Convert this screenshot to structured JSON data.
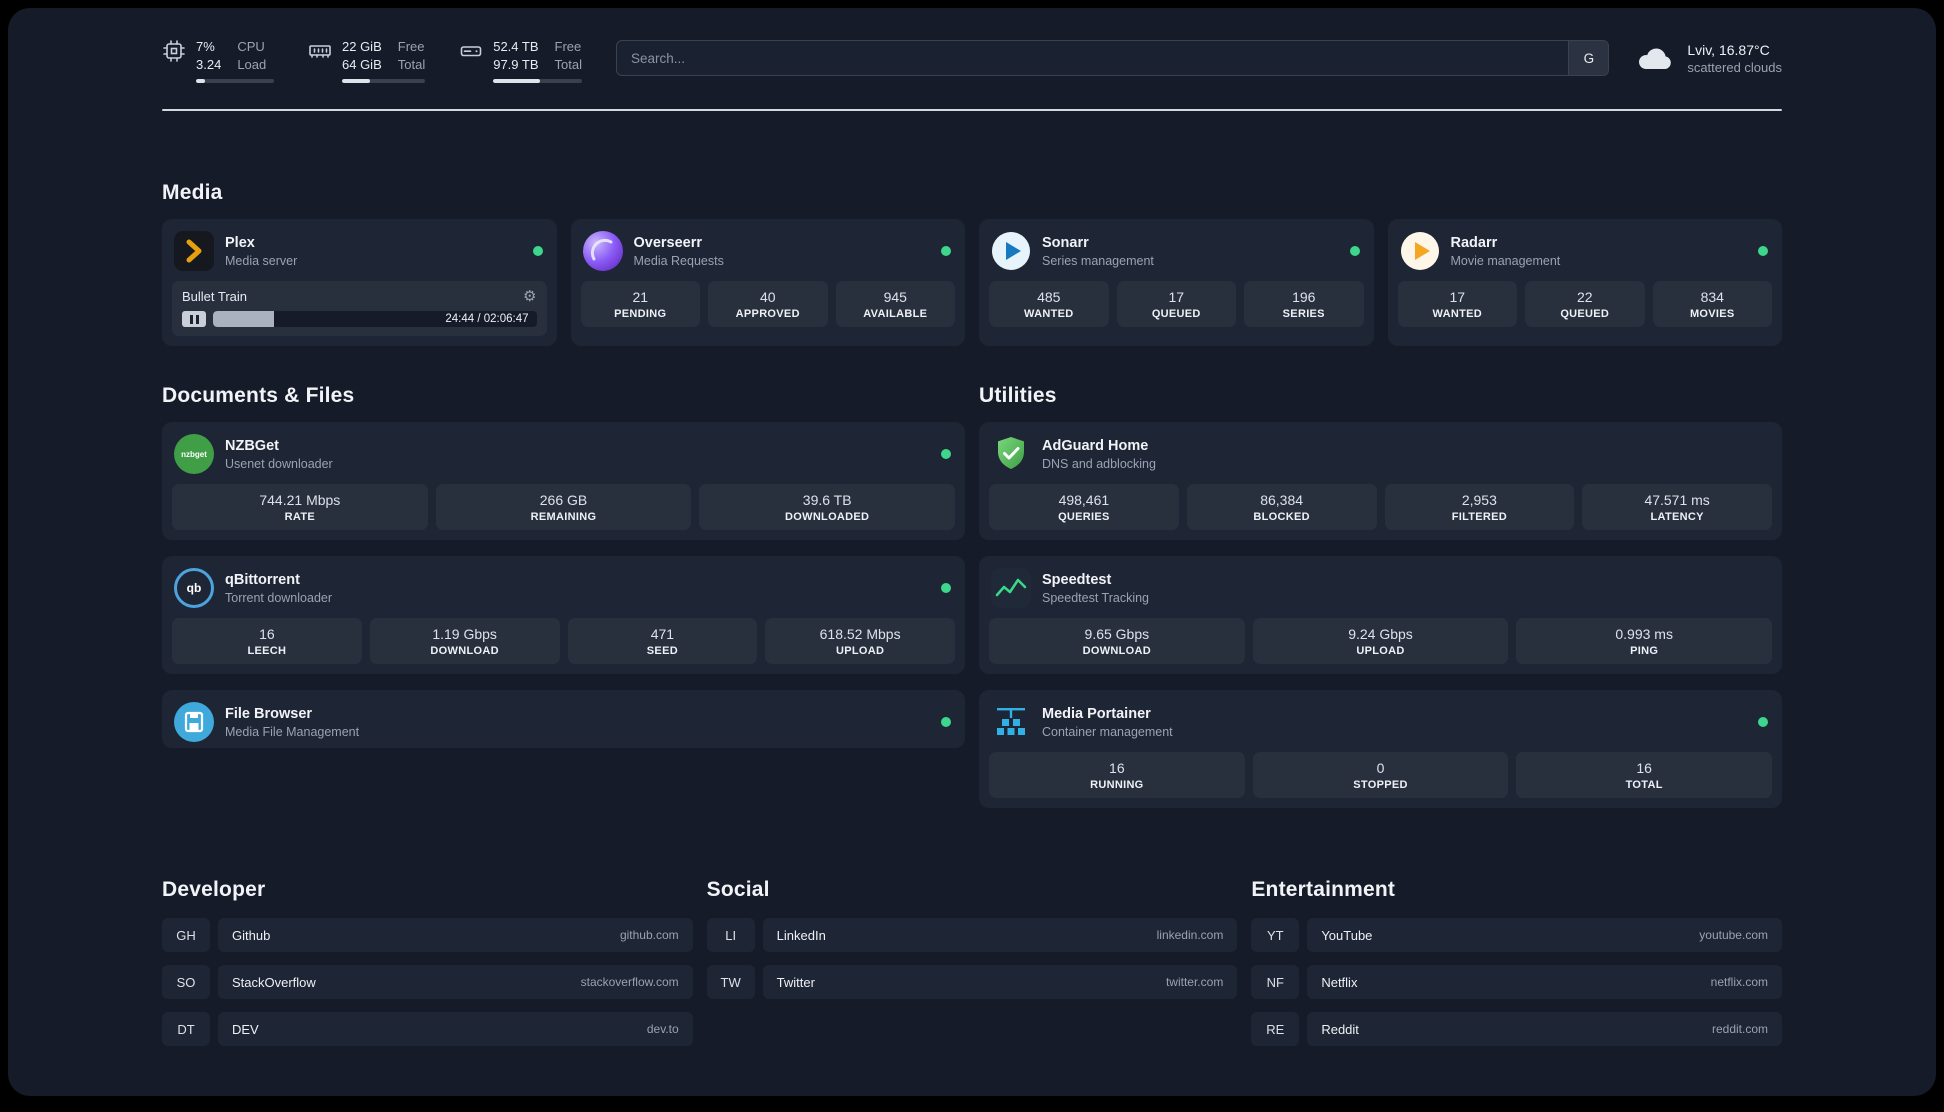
{
  "topbar": {
    "cpu": {
      "value_top": "7%",
      "value_bottom": "3.24",
      "label_top": "CPU",
      "label_bottom": "Load",
      "bar_percent": 12
    },
    "memory": {
      "value_top": "22 GiB",
      "value_bottom": "64 GiB",
      "label_top": "Free",
      "label_bottom": "Total",
      "bar_percent": 34
    },
    "disk": {
      "value_top": "52.4 TB",
      "value_bottom": "97.9 TB",
      "label_top": "Free",
      "label_bottom": "Total",
      "bar_percent": 53
    },
    "search": {
      "placeholder": "Search...",
      "button_label": "G"
    },
    "weather": {
      "location": "Lviv, 16.87°C",
      "condition": "scattered clouds"
    }
  },
  "sections": {
    "media": "Media",
    "documents": "Documents & Files",
    "utilities": "Utilities",
    "developer": "Developer",
    "social": "Social",
    "entertainment": "Entertainment"
  },
  "glyphs": {
    "gear": "⚙"
  },
  "apps": {
    "plex": {
      "name": "Plex",
      "desc": "Media server",
      "now_playing": "Bullet Train",
      "time": "24:44 / 02:06:47",
      "progress_percent": 19
    },
    "overseerr": {
      "name": "Overseerr",
      "desc": "Media Requests",
      "stats": [
        {
          "value": "21",
          "label": "PENDING"
        },
        {
          "value": "40",
          "label": "APPROVED"
        },
        {
          "value": "945",
          "label": "AVAILABLE"
        }
      ]
    },
    "sonarr": {
      "name": "Sonarr",
      "desc": "Series management",
      "stats": [
        {
          "value": "485",
          "label": "WANTED"
        },
        {
          "value": "17",
          "label": "QUEUED"
        },
        {
          "value": "196",
          "label": "SERIES"
        }
      ]
    },
    "radarr": {
      "name": "Radarr",
      "desc": "Movie management",
      "stats": [
        {
          "value": "17",
          "label": "WANTED"
        },
        {
          "value": "22",
          "label": "QUEUED"
        },
        {
          "value": "834",
          "label": "MOVIES"
        }
      ]
    },
    "nzbget": {
      "name": "NZBGet",
      "desc": "Usenet downloader",
      "glyph": "nzbget",
      "stats": [
        {
          "value": "744.21 Mbps",
          "label": "RATE"
        },
        {
          "value": "266 GB",
          "label": "REMAINING"
        },
        {
          "value": "39.6 TB",
          "label": "DOWNLOADED"
        }
      ]
    },
    "qbittorrent": {
      "name": "qBittorrent",
      "desc": "Torrent downloader",
      "glyph": "qb",
      "stats": [
        {
          "value": "16",
          "label": "LEECH"
        },
        {
          "value": "1.19 Gbps",
          "label": "DOWNLOAD"
        },
        {
          "value": "471",
          "label": "SEED"
        },
        {
          "value": "618.52 Mbps",
          "label": "UPLOAD"
        }
      ]
    },
    "filebrowser": {
      "name": "File Browser",
      "desc": "Media File Management"
    },
    "adguard": {
      "name": "AdGuard Home",
      "desc": "DNS and adblocking",
      "stats": [
        {
          "value": "498,461",
          "label": "QUERIES"
        },
        {
          "value": "86,384",
          "label": "BLOCKED"
        },
        {
          "value": "2,953",
          "label": "FILTERED"
        },
        {
          "value": "47.571 ms",
          "label": "LATENCY"
        }
      ]
    },
    "speedtest": {
      "name": "Speedtest",
      "desc": "Speedtest Tracking",
      "stats": [
        {
          "value": "9.65 Gbps",
          "label": "DOWNLOAD"
        },
        {
          "value": "9.24 Gbps",
          "label": "UPLOAD"
        },
        {
          "value": "0.993 ms",
          "label": "PING"
        }
      ]
    },
    "portainer": {
      "name": "Media Portainer",
      "desc": "Container management",
      "stats": [
        {
          "value": "16",
          "label": "RUNNING"
        },
        {
          "value": "0",
          "label": "STOPPED"
        },
        {
          "value": "16",
          "label": "TOTAL"
        }
      ]
    }
  },
  "bookmarks": {
    "developer": [
      {
        "abbr": "GH",
        "name": "Github",
        "url": "github.com"
      },
      {
        "abbr": "SO",
        "name": "StackOverflow",
        "url": "stackoverflow.com"
      },
      {
        "abbr": "DT",
        "name": "DEV",
        "url": "dev.to"
      }
    ],
    "social": [
      {
        "abbr": "LI",
        "name": "LinkedIn",
        "url": "linkedin.com"
      },
      {
        "abbr": "TW",
        "name": "Twitter",
        "url": "twitter.com"
      }
    ],
    "entertainment": [
      {
        "abbr": "YT",
        "name": "YouTube",
        "url": "youtube.com"
      },
      {
        "abbr": "NF",
        "name": "Netflix",
        "url": "netflix.com"
      },
      {
        "abbr": "RE",
        "name": "Reddit",
        "url": "reddit.com"
      }
    ]
  }
}
